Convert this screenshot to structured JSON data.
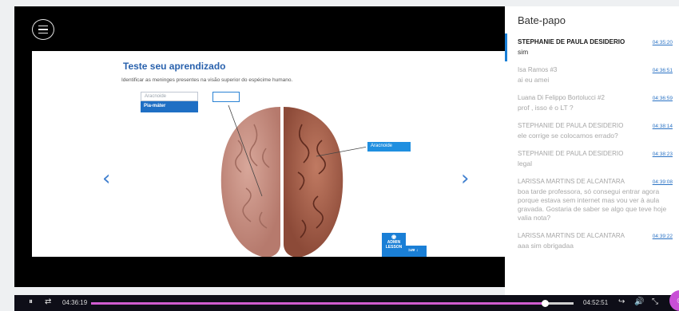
{
  "slide": {
    "title": "Teste seu aprendizado",
    "instruction": "Identificar as meninges presentes na visão superior do espécime humano.",
    "dropdown_options": [
      "Aracnoide",
      "Pia-máter"
    ],
    "label_tag": "Aracnoide",
    "admin_label_line1": "ADMIN",
    "admin_label_line2": "LESSON",
    "admin_tag2": "ɔɹɐ ↓"
  },
  "player": {
    "current_time": "04:36:19",
    "total_time": "04:52:51",
    "progress_fraction": 0.94,
    "accent_color": "#d05cd0"
  },
  "chat": {
    "title": "Bate-papo",
    "messages": [
      {
        "name": "STEPHANIE DE PAULA DESIDERIO",
        "time": "04:35:20",
        "text": "sim",
        "active": true
      },
      {
        "name": "Isa Ramos #3",
        "time": "04:36:51",
        "text": "ai eu amei",
        "active": false
      },
      {
        "name": "Luana Di Felippo Bortolucci #2",
        "time": "04:36:59",
        "text": "prof , isso é o LT ?",
        "active": false
      },
      {
        "name": "STEPHANIE DE PAULA DESIDERIO",
        "time": "04:38:14",
        "text": "ele corrige se colocamos errado?",
        "active": false
      },
      {
        "name": "STEPHANIE DE PAULA DESIDERIO",
        "time": "04:38:23",
        "text": "legal",
        "active": false
      },
      {
        "name": "LARISSA MARTINS DE ALCANTARA",
        "time": "04:39:08",
        "text": "boa tarde professora, só consegui entrar agora porque estava sem internet mas vou ver à aula gravada. Gostaria de saber se algo que teve hoje valia nota?",
        "active": false
      },
      {
        "name": "LARISSA MARTINS DE ALCANTARA",
        "time": "04:39:22",
        "text": "aaa sim obrigadaa",
        "active": false
      }
    ]
  }
}
